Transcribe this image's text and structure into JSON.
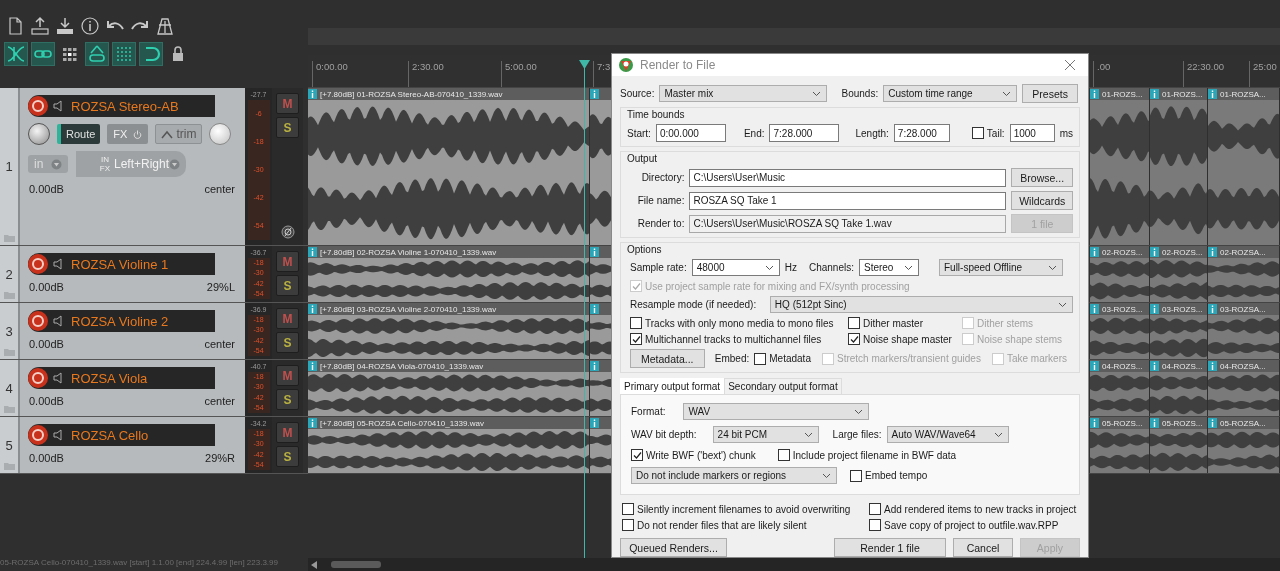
{
  "toolbar": {
    "toggles": [
      {
        "on": true
      },
      {
        "on": true
      },
      {
        "on": false
      },
      {
        "on": true
      },
      {
        "on": true
      },
      {
        "on": true
      },
      {
        "on": false
      }
    ]
  },
  "timeline": {
    "ruler": [
      "0:00.00",
      "2:30.00",
      "5:00.00",
      "7:3",
      ".00",
      "22:30.00",
      "25:00"
    ]
  },
  "tracks": [
    {
      "number": "1",
      "name": "ROZSA Stereo-AB",
      "mute": "M",
      "solo": "S",
      "armed": true,
      "volume": "0.00dB",
      "pan": "center",
      "peak": "-27.7",
      "scale": [
        "-6",
        "-18",
        "-30",
        "-42",
        "-54"
      ],
      "route": "Route",
      "fx": "FX",
      "trim": "trim",
      "input": "in",
      "input_fx": "IN FX",
      "input_channel": "Left+Right",
      "items": [
        {
          "label": "[+7.80dB] 01-ROZSA Stereo-AB-070410_1339.wav"
        },
        {
          "label": "01-ROZS..."
        },
        {
          "label": "01-ROZS..."
        },
        {
          "label": "01-ROZSA..."
        }
      ]
    },
    {
      "number": "2",
      "name": "ROZSA Violine 1",
      "mute": "M",
      "solo": "S",
      "armed": true,
      "volume": "0.00dB",
      "pan": "29%L",
      "peak": "-36.7",
      "scale": [
        "-18",
        "-30",
        "-42",
        "-54"
      ],
      "items": [
        {
          "label": "[+7.80dB] 02-ROZSA Violine 1-070410_1339.wav"
        },
        {
          "label": "02-ROZS..."
        },
        {
          "label": "02-ROZS..."
        },
        {
          "label": "02-ROZSA..."
        }
      ]
    },
    {
      "number": "3",
      "name": "ROZSA Violine 2",
      "mute": "M",
      "solo": "S",
      "armed": true,
      "volume": "0.00dB",
      "pan": "center",
      "peak": "-36.9",
      "scale": [
        "-18",
        "-30",
        "-42",
        "-54"
      ],
      "items": [
        {
          "label": "[+7.80dB] 03-ROZSA Violine 2-070410_1339.wav"
        },
        {
          "label": "03-ROZS..."
        },
        {
          "label": "03-ROZS..."
        },
        {
          "label": "03-ROZSA..."
        }
      ]
    },
    {
      "number": "4",
      "name": "ROZSA Viola",
      "mute": "M",
      "solo": "S",
      "armed": true,
      "volume": "0.00dB",
      "pan": "center",
      "peak": "-40.7",
      "scale": [
        "-18",
        "-30",
        "-42",
        "-54"
      ],
      "items": [
        {
          "label": "[+7.80dB] 04-ROZSA Viola-070410_1339.wav"
        },
        {
          "label": "04-ROZS..."
        },
        {
          "label": "04-ROZS..."
        },
        {
          "label": "04-ROZSA..."
        }
      ]
    },
    {
      "number": "5",
      "name": "ROZSA Cello",
      "mute": "M",
      "solo": "S",
      "armed": true,
      "volume": "0.00dB",
      "pan": "29%R",
      "peak": "-34.2",
      "scale": [
        "-18",
        "-30",
        "-42",
        "-54"
      ],
      "items": [
        {
          "label": "[+7.80dB] 05-ROZSA Cello-070410_1339.wav"
        },
        {
          "label": "05-ROZS..."
        },
        {
          "label": "05-ROZS..."
        },
        {
          "label": "05-ROZSA..."
        }
      ]
    }
  ],
  "status_bar": "05-ROZSA Cello-070410_1339.wav [start] 1.1.00 [end] 224.4.99 [len] 223.3.99",
  "render_dialog": {
    "title": "Render to File",
    "source": {
      "label": "Source:",
      "value": "Master mix"
    },
    "bounds": {
      "label": "Bounds:",
      "value": "Custom time range"
    },
    "presets": "Presets",
    "time_bounds": {
      "title": "Time bounds",
      "start_label": "Start:",
      "start": "0:00.000",
      "end_label": "End:",
      "end": "7:28.000",
      "length_label": "Length:",
      "length": "7:28.000",
      "tail": {
        "label": "Tail:",
        "checked": false
      },
      "tail_value": "1000",
      "tail_unit": "ms"
    },
    "output": {
      "title": "Output",
      "rows": [
        {
          "label": "Directory:",
          "value": "C:\\Users\\User\\Music",
          "readonly": false,
          "button": "Browse...",
          "disabled": false
        },
        {
          "label": "File name:",
          "value": "ROSZA SQ Take 1",
          "readonly": false,
          "button": "Wildcards",
          "disabled": false
        },
        {
          "label": "Render to:",
          "value": "C:\\Users\\User\\Music\\ROSZA SQ Take 1.wav",
          "readonly": true,
          "button": "1 file",
          "disabled": true
        }
      ]
    },
    "options": {
      "title": "Options",
      "sample_rate_label": "Sample rate:",
      "sample_rate": "48000",
      "hz": "Hz",
      "channels_label": "Channels:",
      "channels": "Stereo",
      "mode": "Full-speed Offline",
      "use_project_rate": {
        "label": "Use project sample rate for mixing and FX/synth processing",
        "checked": true,
        "disabled": true
      },
      "resample_label": "Resample mode (if needed):",
      "resample": "HQ (512pt Sinc)",
      "checkboxes": [
        {
          "label": "Tracks with only mono media to mono files",
          "checked": false,
          "disabled": false
        },
        {
          "label": "Dither master",
          "checked": false,
          "disabled": false
        },
        {
          "label": "Dither stems",
          "checked": false,
          "disabled": true
        },
        {
          "label": "Multichannel tracks to multichannel files",
          "checked": true,
          "disabled": false
        },
        {
          "label": "Noise shape master",
          "checked": true,
          "disabled": false
        },
        {
          "label": "Noise shape stems",
          "checked": false,
          "disabled": true
        }
      ],
      "metadata_button": "Metadata...",
      "embed_label": "Embed:",
      "embed": [
        {
          "label": "Metadata",
          "checked": false,
          "disabled": false
        },
        {
          "label": "Stretch markers/transient guides",
          "checked": false,
          "disabled": true
        },
        {
          "label": "Take markers",
          "checked": false,
          "disabled": true
        }
      ]
    },
    "format_tabs": [
      {
        "label": "Primary output format",
        "selected": true
      },
      {
        "label": "Secondary output format",
        "selected": false
      }
    ],
    "format": {
      "format_label": "Format:",
      "format": "WAV",
      "bit_depth_label": "WAV bit depth:",
      "bit_depth": "24 bit PCM",
      "large_files_label": "Large files:",
      "large_files": "Auto WAV/Wave64",
      "bwf": {
        "label": "Write BWF ('bext') chunk",
        "checked": true
      },
      "include_filename": {
        "label": "Include project filename in BWF data",
        "checked": false
      },
      "markers": "Do not include markers or regions",
      "embed_tempo": {
        "label": "Embed tempo",
        "checked": false
      }
    },
    "bottom_options": [
      {
        "label": "Silently increment filenames to avoid overwriting",
        "checked": false
      },
      {
        "label": "Add rendered items to new tracks in project",
        "checked": false
      },
      {
        "label": "Do not render files that are likely silent",
        "checked": false
      },
      {
        "label": "Save copy of project to outfile.wav.RPP",
        "checked": false
      }
    ],
    "buttons": [
      {
        "label": "Queued Renders...",
        "disabled": false
      },
      {
        "label": "Render 1 file",
        "disabled": false
      },
      {
        "label": "Cancel",
        "disabled": false
      },
      {
        "label": "Apply",
        "disabled": true
      }
    ]
  }
}
